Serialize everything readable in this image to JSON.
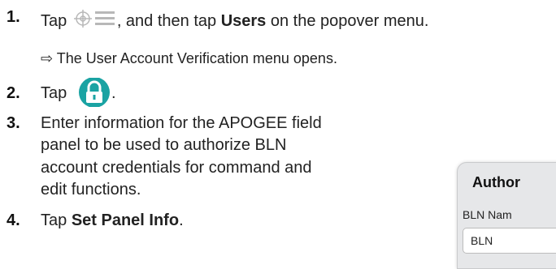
{
  "steps": [
    {
      "num": "1.",
      "before": "Tap",
      "after": ", and then tap",
      "bold": "Users",
      "end": "on the popover menu."
    },
    {
      "num": "2.",
      "text": "Tap",
      "end": "."
    },
    {
      "num": "3.",
      "lines": [
        "Enter information for the APOGEE field",
        "panel to be used to authorize BLN",
        "account credentials for command and",
        "edit functions."
      ]
    },
    {
      "num": "4.",
      "before": "Tap",
      "bold": "Set Panel Info",
      "end": "."
    }
  ],
  "result": "⇨ The User Account Verification menu opens.",
  "dialog": {
    "title": "Author",
    "field_label": "BLN Nam",
    "field_value": "BLN"
  },
  "colors": {
    "lock_button": "#1aa3a3"
  }
}
